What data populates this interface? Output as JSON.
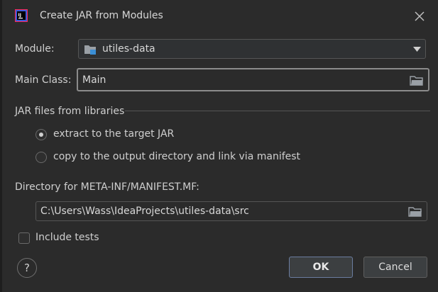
{
  "window": {
    "title": "Create JAR from Modules"
  },
  "module": {
    "label": "Module:",
    "value": "utiles-data"
  },
  "main_class": {
    "label": "Main Class:",
    "value": "Main"
  },
  "libraries": {
    "heading": "JAR files from libraries",
    "options": [
      {
        "label": "extract to the target JAR",
        "selected": true
      },
      {
        "label": "copy to the output directory and link via manifest",
        "selected": false
      }
    ]
  },
  "manifest": {
    "label": "Directory for META-INF/MANIFEST.MF:",
    "value": "C:\\Users\\Wass\\IdeaProjects\\utiles-data\\src"
  },
  "include_tests": {
    "label": "Include tests",
    "checked": false
  },
  "help": {
    "label": "?"
  },
  "buttons": {
    "ok": "OK",
    "cancel": "Cancel"
  },
  "colors": {
    "background": "#2b2b2b",
    "ok_border": "#6b7da0",
    "icon_blue": "#3b8fd6"
  }
}
